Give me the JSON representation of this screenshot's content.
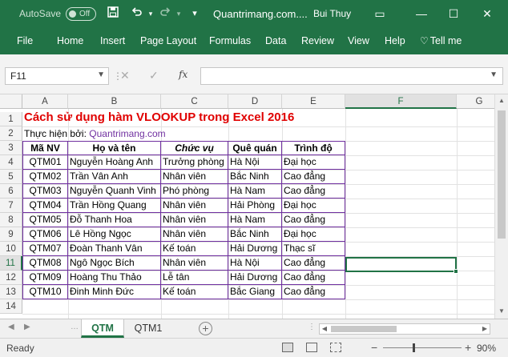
{
  "titlebar": {
    "autosave_label": "AutoSave",
    "autosave_state": "Off",
    "document_title": "Quantrimang.com....",
    "user_name": "Bui Thuy",
    "icons": [
      "save-icon",
      "undo-icon",
      "redo-icon",
      "customize-icon"
    ],
    "window_buttons": {
      "ribbon_display": "▭",
      "minimize": "—",
      "maximize": "☐",
      "close": "✕"
    }
  },
  "ribbon": {
    "tabs": [
      "File",
      "Home",
      "Insert",
      "Page Layout",
      "Formulas",
      "Data",
      "Review",
      "View",
      "Help"
    ],
    "tell_me": "Tell me"
  },
  "formula_bar": {
    "name_box": "F11",
    "fx_label": "fx",
    "formula": ""
  },
  "columns": [
    "A",
    "B",
    "C",
    "D",
    "E",
    "F",
    "G"
  ],
  "rows": [
    "1",
    "2",
    "3",
    "4",
    "5",
    "6",
    "7",
    "8",
    "9",
    "10",
    "11",
    "12",
    "13",
    "14"
  ],
  "sheet": {
    "title": "Cách sử dụng hàm VLOOKUP trong Excel 2016",
    "author_label": "Thực hiện bởi:",
    "author_site": "Quantrimang.com",
    "headers": [
      "Mã NV",
      "Họ và tên",
      "Chức vụ",
      "Quê quán",
      "Trình độ"
    ],
    "records": [
      [
        "QTM01",
        "Nguyễn Hoàng Anh",
        "Trưởng phòng",
        "Hà Nội",
        "Đại học"
      ],
      [
        "QTM02",
        "Trần Vân Anh",
        "Nhân viên",
        "Bắc Ninh",
        "Cao đẳng"
      ],
      [
        "QTM03",
        "Nguyễn Quanh Vinh",
        "Phó phòng",
        "Hà Nam",
        "Cao đẳng"
      ],
      [
        "QTM04",
        "Trần Hồng Quang",
        "Nhân viên",
        "Hải Phòng",
        "Đại học"
      ],
      [
        "QTM05",
        "Đỗ Thanh Hoa",
        "Nhân viên",
        "Hà Nam",
        "Cao đẳng"
      ],
      [
        "QTM06",
        "Lê Hồng Ngọc",
        "Nhân viên",
        "Bắc Ninh",
        "Đại học"
      ],
      [
        "QTM07",
        "Đoàn Thanh Vân",
        "Kế toán",
        "Hải Dương",
        "Thạc sĩ"
      ],
      [
        "QTM08",
        "Ngô Ngọc Bích",
        "Nhân viên",
        "Hà Nội",
        "Cao đẳng"
      ],
      [
        "QTM09",
        "Hoàng Thu Thảo",
        "Lễ tân",
        "Hải Dương",
        "Cao đẳng"
      ],
      [
        "QTM10",
        "Đinh Minh Đức",
        "Kế toán",
        "Bắc Giang",
        "Cao đẳng"
      ]
    ]
  },
  "active_cell": "F11",
  "sheet_tabs": [
    "QTM",
    "QTM1"
  ],
  "active_sheet": "QTM",
  "status": {
    "ready": "Ready",
    "zoom": "90%"
  },
  "colors": {
    "excel_green": "#217346",
    "title_red": "#e00000",
    "table_border": "#7030a0",
    "link_purple": "#7030a0"
  }
}
